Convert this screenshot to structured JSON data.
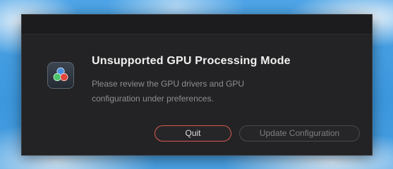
{
  "dialog": {
    "title": "Unsupported GPU Processing Mode",
    "message": "Please review the GPU drivers and GPU configuration under preferences.",
    "icon": "davinci-resolve-app-icon",
    "buttons": {
      "quit_label": "Quit",
      "update_label": "Update Configuration"
    }
  },
  "colors": {
    "dialog_background": "#232325",
    "title_text": "#f0f0f0",
    "message_text": "#8e8e93",
    "quit_border": "#d85a4c",
    "icon_dot_blue": "#4a8fe0",
    "icon_dot_green": "#4cc56a",
    "icon_dot_red": "#e2453c"
  }
}
